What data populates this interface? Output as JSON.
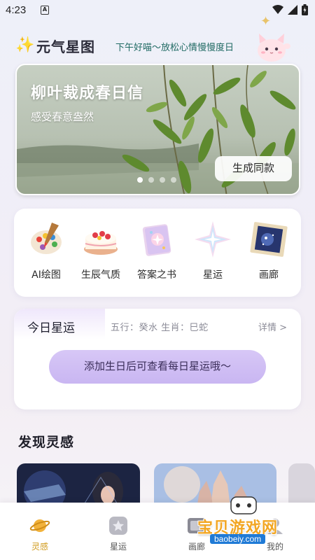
{
  "status": {
    "time": "4:23",
    "notification_icon": "A"
  },
  "header": {
    "title": "元气星图",
    "greeting": "下午好喵～放松心情慢慢度日"
  },
  "banner": {
    "title": "柳叶裁成春日信",
    "subtitle": "感受春意盎然",
    "button": "生成同款",
    "page_count": 4,
    "active_index": 0
  },
  "tools": [
    {
      "label": "AI绘图",
      "icon": "palette-icon"
    },
    {
      "label": "生辰气质",
      "icon": "cake-icon"
    },
    {
      "label": "答案之书",
      "icon": "book-icon"
    },
    {
      "label": "星运",
      "icon": "star-icon"
    },
    {
      "label": "画廊",
      "icon": "picture-frame-icon"
    }
  ],
  "fortune": {
    "title": "今日星运",
    "meta": "五行：癸水  生肖：巳蛇",
    "detail": "详情 >",
    "button": "添加生日后可查看每日星运哦～"
  },
  "discover": {
    "title": "发现灵感"
  },
  "tabbar": [
    {
      "label": "灵感",
      "icon": "planet-icon",
      "active": true
    },
    {
      "label": "星运",
      "icon": "star-badge-icon",
      "active": false
    },
    {
      "label": "画廊",
      "icon": "gallery-icon",
      "active": false
    },
    {
      "label": "我的",
      "icon": "profile-icon",
      "active": false
    }
  ],
  "watermark": {
    "text": "宝贝游戏网",
    "url": "baobeiy.com"
  },
  "colors": {
    "accent": "#d09a1c",
    "greeting": "#1f6a63",
    "fortune_button": "#cbb8f3"
  }
}
